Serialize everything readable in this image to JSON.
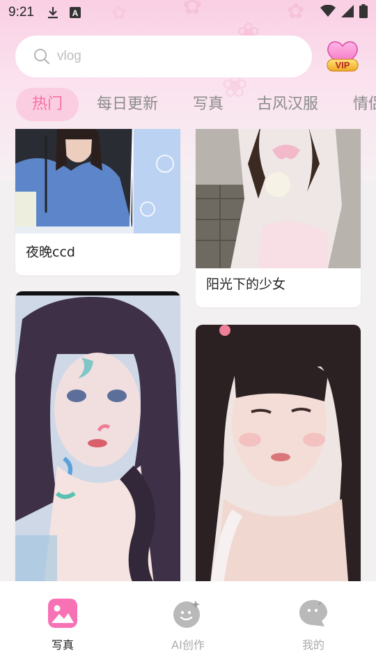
{
  "status_bar": {
    "time": "9:21",
    "left_icons": [
      "download-icon",
      "a-badge-icon"
    ],
    "right_icons": [
      "wifi-icon",
      "signal-icon",
      "battery-icon"
    ]
  },
  "search": {
    "placeholder": "vlog"
  },
  "vip": {
    "label": "VIP",
    "icon": "vip-heart-icon"
  },
  "tabs": [
    {
      "label": "热门",
      "active": true
    },
    {
      "label": "每日更新",
      "active": false
    },
    {
      "label": "写真",
      "active": false
    },
    {
      "label": "古风汉服",
      "active": false
    },
    {
      "label": "情侣",
      "active": false
    }
  ],
  "feed": {
    "cards": [
      {
        "title": "夜晚ccd",
        "image": "photo-girl-umbrella-blue-sweater"
      },
      {
        "title": "阳光下的少女",
        "image": "photo-girl-white-dress-sunlight"
      },
      {
        "title": "",
        "image": "photo-girl-face-paint-purple-hair"
      },
      {
        "title": "",
        "image": "photo-girl-long-dark-hair"
      }
    ]
  },
  "bottom_nav": [
    {
      "label": "写真",
      "icon": "photo-gallery-icon",
      "active": true
    },
    {
      "label": "AI创作",
      "icon": "ai-face-icon",
      "active": false
    },
    {
      "label": "我的",
      "icon": "profile-chat-icon",
      "active": false
    }
  ],
  "colors": {
    "accent_pink": "#f76fa5",
    "tab_active_bg": "#fbcde0",
    "header_gradient_top": "#f9cfe4"
  }
}
